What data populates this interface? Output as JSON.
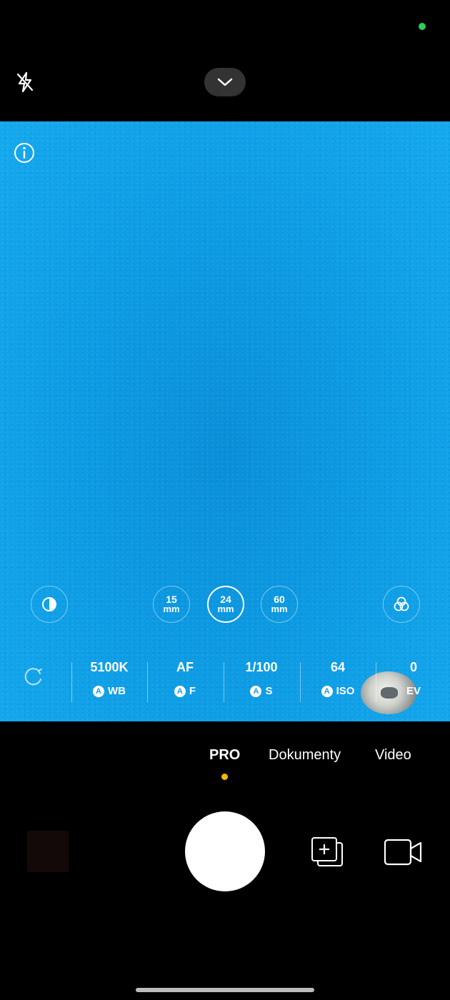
{
  "status": {
    "dot_color": "#2ecc5a"
  },
  "top_bar": {
    "flash_icon": "flash-off-icon",
    "collapse_icon": "chevron-down-icon"
  },
  "viewfinder": {
    "info_icon": "info-icon",
    "lenses": [
      {
        "top": "15",
        "bottom": "mm",
        "active": false
      },
      {
        "top": "24",
        "bottom": "mm",
        "active": true
      },
      {
        "top": "60",
        "bottom": "mm",
        "active": false
      }
    ],
    "left_icon": "contrast-icon",
    "right_icon": "filters-icon"
  },
  "pro_settings": {
    "reset_icon": "reset-icon",
    "auto_badge": "A",
    "params": [
      {
        "value": "5100K",
        "label": "WB",
        "auto": true
      },
      {
        "value": "AF",
        "label": "F",
        "auto": true
      },
      {
        "value": "1/100",
        "label": "S",
        "auto": true
      },
      {
        "value": "64",
        "label": "ISO",
        "auto": true
      },
      {
        "value": "0",
        "label": "EV",
        "auto": false
      }
    ]
  },
  "modes": {
    "items": [
      "PRO",
      "Dokumenty",
      "Video"
    ],
    "active": "PRO",
    "indicator_color": "#f5b800"
  },
  "bottom": {
    "gallery_icon": "gallery-thumbnail",
    "shutter_icon": "shutter-button",
    "multi_icon": "add-photo-icon",
    "video_icon": "video-camera-icon"
  }
}
